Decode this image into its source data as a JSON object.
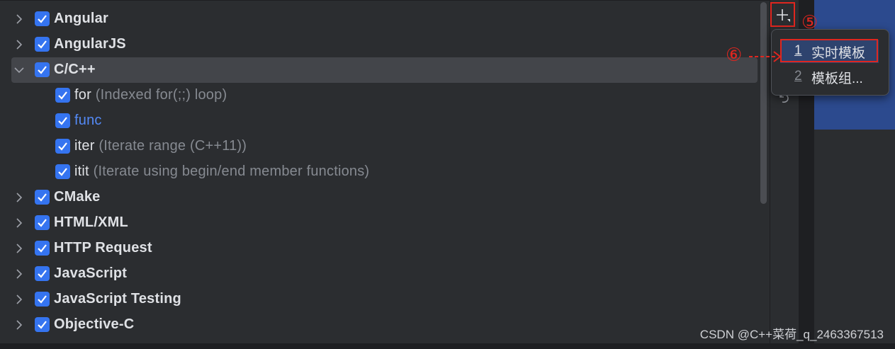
{
  "tree": {
    "groups_top": [
      {
        "label": "Angular",
        "expanded": false,
        "checked": true
      },
      {
        "label": "AngularJS",
        "expanded": false,
        "checked": true
      },
      {
        "label": "C/C++",
        "expanded": true,
        "checked": true
      }
    ],
    "children": [
      {
        "name": "for",
        "desc": "(Indexed for(;;) loop)",
        "checked": true,
        "modified": false
      },
      {
        "name": "func",
        "desc": "",
        "checked": true,
        "modified": true
      },
      {
        "name": "iter",
        "desc": "(Iterate range (C++11))",
        "checked": true,
        "modified": false
      },
      {
        "name": "itit",
        "desc": "(Iterate using begin/end member functions)",
        "checked": true,
        "modified": false
      }
    ],
    "groups_bottom": [
      {
        "label": "CMake",
        "expanded": false,
        "checked": true
      },
      {
        "label": "HTML/XML",
        "expanded": false,
        "checked": true
      },
      {
        "label": "HTTP Request",
        "expanded": false,
        "checked": true
      },
      {
        "label": "JavaScript",
        "expanded": false,
        "checked": true
      },
      {
        "label": "JavaScript Testing",
        "expanded": false,
        "checked": true
      },
      {
        "label": "Objective-C",
        "expanded": false,
        "checked": true
      }
    ]
  },
  "toolbar": {
    "add_icon": "plus-icon",
    "undo_icon": "undo-icon"
  },
  "popup_menu": {
    "items": [
      {
        "mnemonic": "1",
        "label": "实时模板",
        "selected": true
      },
      {
        "mnemonic": "2",
        "label": "模板组...",
        "selected": false
      }
    ]
  },
  "annotations": {
    "step5": "⑤",
    "step6": "⑥"
  },
  "watermark": "CSDN @C++菜荷_q_2463367513",
  "colors": {
    "accent": "#3574f0",
    "highlight_red": "#e0261f",
    "modified_link": "#548af7"
  }
}
